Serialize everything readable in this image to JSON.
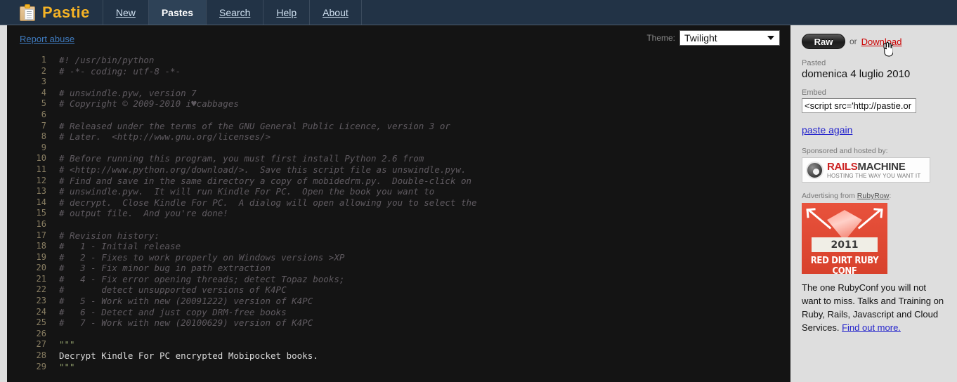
{
  "header": {
    "brand": "Pastie",
    "logo_icon": "clipboard-icon",
    "nav": [
      {
        "label": "New",
        "active": false
      },
      {
        "label": "Pastes",
        "active": true
      },
      {
        "label": "Search",
        "active": false
      },
      {
        "label": "Help",
        "active": false
      },
      {
        "label": "About",
        "active": false
      }
    ]
  },
  "toolbar": {
    "report_abuse": "Report abuse",
    "theme_label": "Theme:",
    "theme_value": "Twilight",
    "theme_caret_icon": "chevron-down-icon"
  },
  "code": {
    "lines": [
      {
        "n": "1",
        "text": "#! /usr/bin/python",
        "style": "comment"
      },
      {
        "n": "2",
        "text": "# -*- coding: utf-8 -*-",
        "style": "comment"
      },
      {
        "n": "3",
        "text": "",
        "style": "comment"
      },
      {
        "n": "4",
        "text": "# unswindle.pyw, version 7",
        "style": "comment"
      },
      {
        "n": "5",
        "text": "# Copyright © 2009-2010 i♥cabbages",
        "style": "comment"
      },
      {
        "n": "6",
        "text": "",
        "style": "comment"
      },
      {
        "n": "7",
        "text": "# Released under the terms of the GNU General Public Licence, version 3 or",
        "style": "comment"
      },
      {
        "n": "8",
        "text": "# Later.  <http://www.gnu.org/licenses/>",
        "style": "comment"
      },
      {
        "n": "9",
        "text": "",
        "style": "comment"
      },
      {
        "n": "10",
        "text": "# Before running this program, you must first install Python 2.6 from",
        "style": "comment"
      },
      {
        "n": "11",
        "text": "# <http://www.python.org/download/>.  Save this script file as unswindle.pyw.",
        "style": "comment"
      },
      {
        "n": "12",
        "text": "# Find and save in the same directory a copy of mobidedrm.py.  Double-click on",
        "style": "comment"
      },
      {
        "n": "13",
        "text": "# unswindle.pyw.  It will run Kindle For PC.  Open the book you want to",
        "style": "comment"
      },
      {
        "n": "14",
        "text": "# decrypt.  Close Kindle For PC.  A dialog will open allowing you to select the",
        "style": "comment"
      },
      {
        "n": "15",
        "text": "# output file.  And you're done!",
        "style": "comment"
      },
      {
        "n": "16",
        "text": "",
        "style": "comment"
      },
      {
        "n": "17",
        "text": "# Revision history:",
        "style": "comment"
      },
      {
        "n": "18",
        "text": "#   1 - Initial release",
        "style": "comment"
      },
      {
        "n": "19",
        "text": "#   2 - Fixes to work properly on Windows versions >XP",
        "style": "comment"
      },
      {
        "n": "20",
        "text": "#   3 - Fix minor bug in path extraction",
        "style": "comment"
      },
      {
        "n": "21",
        "text": "#   4 - Fix error opening threads; detect Topaz books;",
        "style": "comment"
      },
      {
        "n": "22",
        "text": "#       detect unsupported versions of K4PC",
        "style": "comment"
      },
      {
        "n": "23",
        "text": "#   5 - Work with new (20091222) version of K4PC",
        "style": "comment"
      },
      {
        "n": "24",
        "text": "#   6 - Detect and just copy DRM-free books",
        "style": "comment"
      },
      {
        "n": "25",
        "text": "#   7 - Work with new (20100629) version of K4PC",
        "style": "comment"
      },
      {
        "n": "26",
        "text": "",
        "style": "comment"
      },
      {
        "n": "27",
        "text": "\"\"\"",
        "style": "doc"
      },
      {
        "n": "28",
        "text": "Decrypt Kindle For PC encrypted Mobipocket books.",
        "style": "plain"
      },
      {
        "n": "29",
        "text": "\"\"\"",
        "style": "doc"
      }
    ]
  },
  "sidebar": {
    "raw_label": "Raw",
    "or_label": "or",
    "download_label": "Download",
    "cursor_icon": "pointing-hand-cursor",
    "pasted_label": "Pasted",
    "pasted_date": "domenica 4 luglio 2010",
    "embed_label": "Embed",
    "embed_value": "<script src='http://pastie.or",
    "paste_again_label": "paste again",
    "sponsor_label": "Sponsored and hosted by:",
    "sponsor": {
      "gear_icon": "gear-icon",
      "name_part1": "RAILS",
      "name_part2": "MACHINE",
      "tagline": "HOSTING THE WAY YOU WANT IT"
    },
    "advertising_prefix": "Advertising from ",
    "advertising_link": "RubyRow",
    "advertising_suffix": ":",
    "ad": {
      "year": "2011",
      "conf_name": "RED DIRT RUBY CONF",
      "copy": "The one RubyConf you will not want to miss. Talks and Training on Ruby, Rails, Javascript and Cloud Services.",
      "find_out_more": "Find out more."
    }
  },
  "colors": {
    "header_bg": "#223346",
    "brand": "#f5b325",
    "code_bg": "#141414",
    "download_link": "#cc0000",
    "link_blue": "#2222cc",
    "page_bg": "#dedede"
  }
}
